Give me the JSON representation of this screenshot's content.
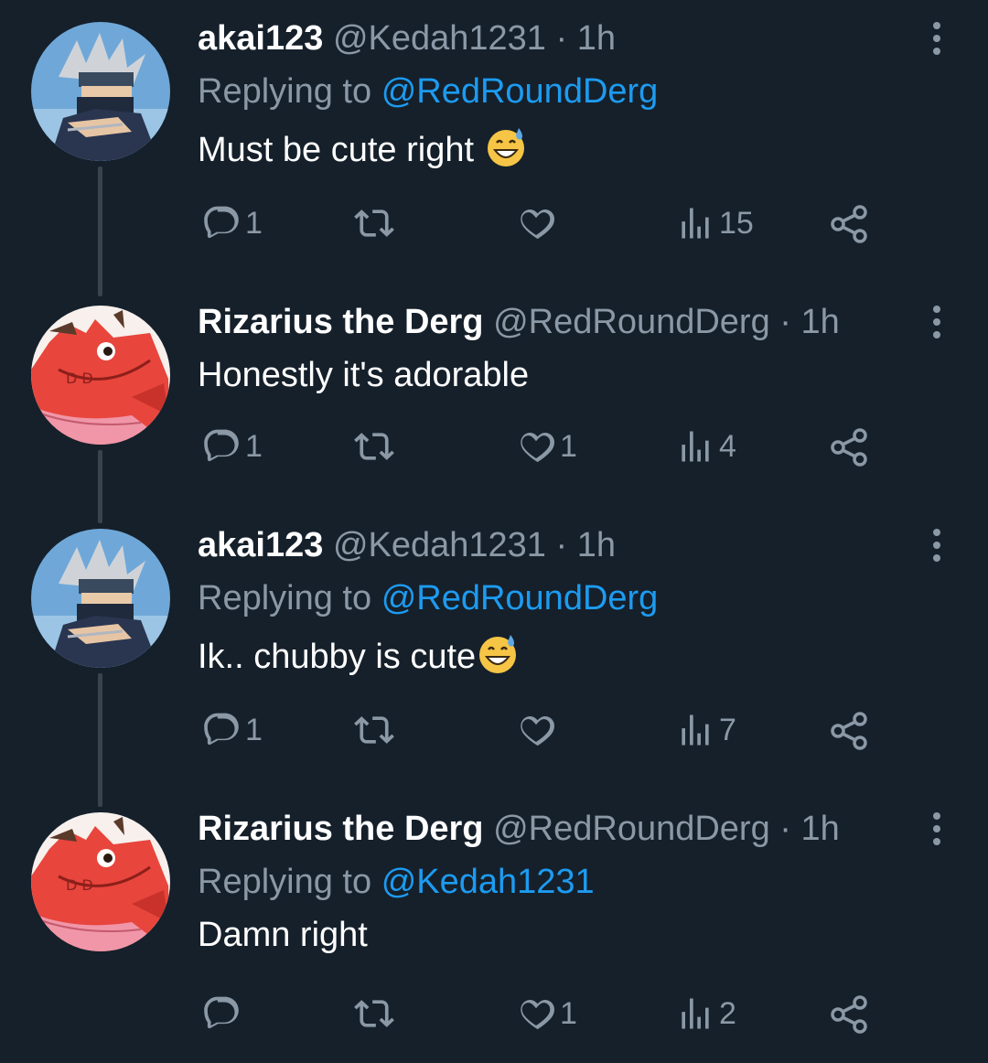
{
  "tweets": [
    {
      "display_name": "akai123",
      "handle": "@Kedah1231",
      "separator": "·",
      "time": "1h",
      "replying_prefix": "Replying to",
      "replying_to": "@RedRoundDerg",
      "text": "Must be cute right ",
      "emoji": "sweat-smile-emoji",
      "avatar": "ninja-avatar",
      "replies": "1",
      "retweets": "",
      "likes": "",
      "views": "15"
    },
    {
      "display_name": "Rizarius the Derg",
      "handle": "@RedRoundDerg",
      "separator": "·",
      "time": "1h",
      "replying_prefix": "",
      "replying_to": "",
      "text": "Honestly it's adorable",
      "emoji": "",
      "avatar": "red-dragon-avatar",
      "replies": "1",
      "retweets": "",
      "likes": "1",
      "views": "4"
    },
    {
      "display_name": "akai123",
      "handle": "@Kedah1231",
      "separator": "·",
      "time": "1h",
      "replying_prefix": "Replying to",
      "replying_to": "@RedRoundDerg",
      "text": "Ik.. chubby is cute",
      "emoji": "sweat-smile-emoji",
      "avatar": "ninja-avatar",
      "replies": "1",
      "retweets": "",
      "likes": "",
      "views": "7"
    },
    {
      "display_name": "Rizarius the Derg",
      "handle": "@RedRoundDerg",
      "separator": "·",
      "time": "1h",
      "replying_prefix": "Replying to",
      "replying_to": "@Kedah1231",
      "text": "Damn right",
      "emoji": "",
      "avatar": "red-dragon-avatar",
      "replies": "",
      "retweets": "",
      "likes": "1",
      "views": "2"
    }
  ],
  "icons": {
    "reply": "reply-icon",
    "retweet": "retweet-icon",
    "like": "heart-icon",
    "views": "views-icon",
    "share": "share-icon",
    "more": "more-options-icon"
  },
  "colors": {
    "background": "#15202b",
    "text_primary": "#ffffff",
    "text_secondary": "#8b98a5",
    "link": "#1d9bf0",
    "thread_line": "#38444d"
  }
}
